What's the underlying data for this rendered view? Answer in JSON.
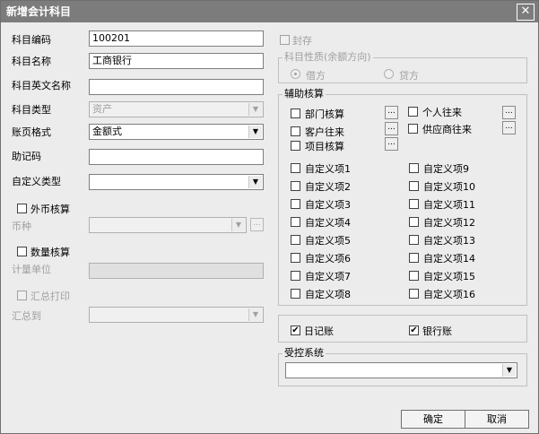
{
  "window": {
    "title": "新增会计科目",
    "close": "✕"
  },
  "left": {
    "code_label": "科目编码",
    "code_value": "100201",
    "name_label": "科目名称",
    "name_value": "工商银行",
    "en_label": "科目英文名称",
    "en_value": "",
    "type_label": "科目类型",
    "type_value": "资产",
    "format_label": "账页格式",
    "format_value": "金额式",
    "mnemonic_label": "助记码",
    "mnemonic_value": "",
    "custom_type_label": "自定义类型",
    "custom_type_value": "",
    "fx_label": "外币核算",
    "currency_label": "币种",
    "currency_value": "",
    "qty_label": "数量核算",
    "unit_label": "计量单位",
    "unit_value": "",
    "summary_print_label": "汇总打印",
    "summary_to_label": "汇总到",
    "summary_to_value": ""
  },
  "right": {
    "sealed_label": "封存",
    "nature_title": "科目性质(余额方向)",
    "debit_label": "借方",
    "credit_label": "贷方",
    "aux_title": "辅助核算",
    "aux_items": {
      "dept": "部门核算",
      "personal": "个人往来",
      "customer": "客户往来",
      "supplier": "供应商往来",
      "project": "项目核算"
    },
    "custom_items": [
      "自定义项1",
      "自定义项2",
      "自定义项3",
      "自定义项4",
      "自定义项5",
      "自定义项6",
      "自定义项7",
      "自定义项8",
      "自定义项9",
      "自定义项10",
      "自定义项11",
      "自定义项12",
      "自定义项13",
      "自定义项14",
      "自定义项15",
      "自定义项16"
    ],
    "journal_label": "日记账",
    "bank_label": "银行账",
    "controlled_title": "受控系统",
    "controlled_value": ""
  },
  "buttons": {
    "ok": "确定",
    "cancel": "取消"
  },
  "icons": {
    "ellipsis": "...",
    "arrow": "▼",
    "check": "✔"
  }
}
